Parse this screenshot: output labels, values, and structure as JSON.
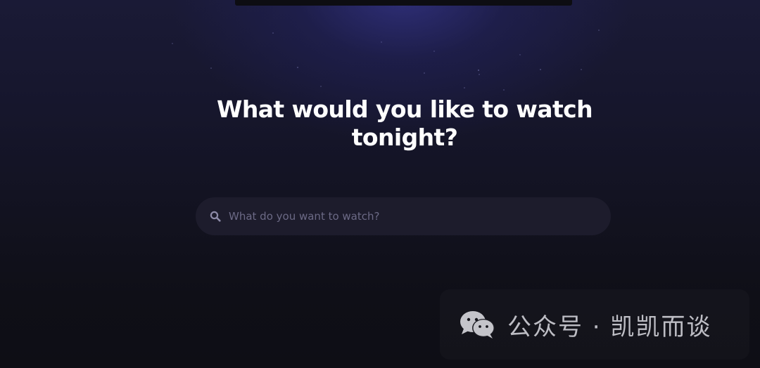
{
  "hero": {
    "headline": "What would you like to watch tonight?"
  },
  "search": {
    "placeholder": "What do you want to watch?",
    "value": "",
    "icon": "search-icon"
  },
  "watermark": {
    "text": "公众号 · 凯凯而谈",
    "icon": "wechat-icon"
  },
  "colors": {
    "background": "#0f0f17",
    "glow": "#30307d",
    "headline": "#ffffff",
    "search_bg": "#1d1c2c",
    "placeholder": "#6c6a86"
  }
}
